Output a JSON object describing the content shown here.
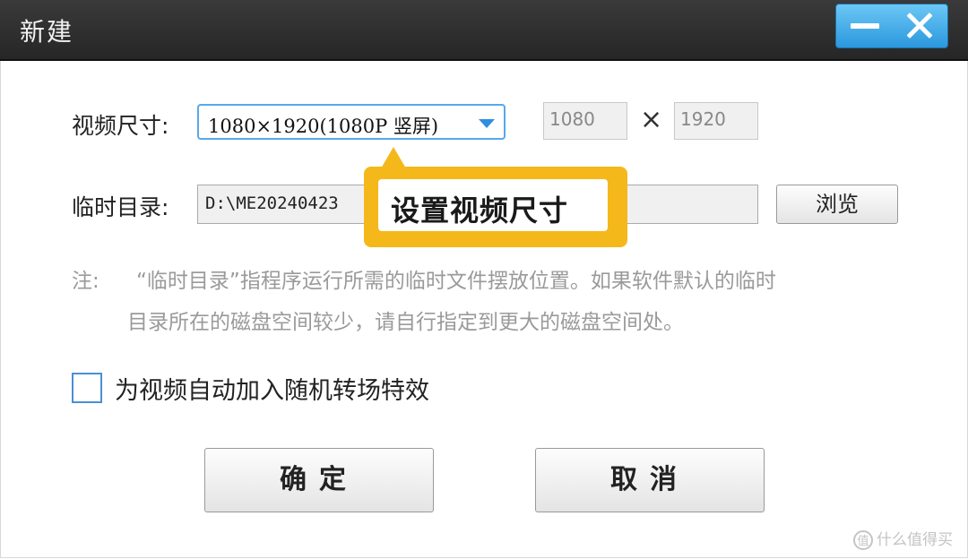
{
  "window": {
    "title": "新建",
    "minimize_icon": "minimize-icon",
    "close_icon": "close-icon",
    "accent_color": "#2b98dd"
  },
  "video_size": {
    "label": "视频尺寸:",
    "selected": "1080×1920(1080P 竖屏)",
    "width": "1080",
    "times": "×",
    "height": "1920"
  },
  "temp_dir": {
    "label": "临时目录:",
    "value": "D:\\ME20240423",
    "browse_label": "浏览"
  },
  "note": {
    "prefix": "注:",
    "line1": "“临时目录”指程序运行所需的临时文件摆放位置。如果软件默认的临时",
    "line2": "目录所在的磁盘空间较少，请自行指定到更大的磁盘空间处。"
  },
  "transition": {
    "checked": false,
    "label": "为视频自动加入随机转场特效"
  },
  "buttons": {
    "ok": "确定",
    "cancel": "取消"
  },
  "callout": {
    "text": "设置视频尺寸",
    "color": "#f5b81b"
  },
  "watermark": {
    "icon_text": "值",
    "text": "什么值得买"
  }
}
